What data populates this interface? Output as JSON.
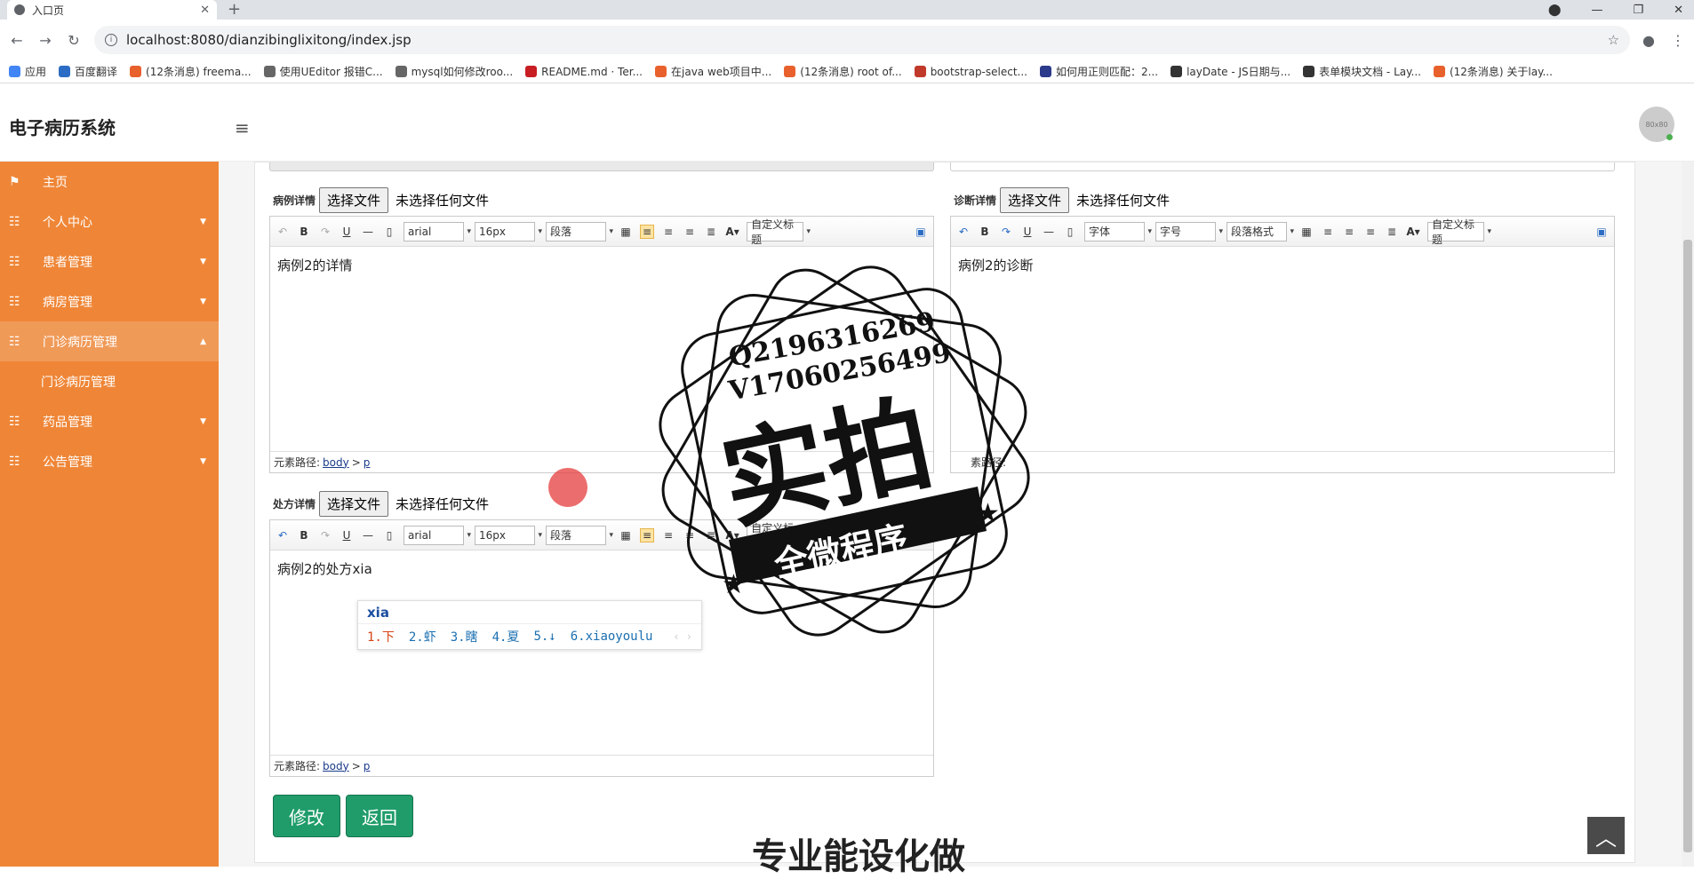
{
  "browser": {
    "tab_title": "入口页",
    "tab_close": "✕",
    "new_tab": "+",
    "url": "localhost:8080/dianzibinglixitong/index.jsp",
    "bookmarks": [
      {
        "label": "应用",
        "color": "#4285f4"
      },
      {
        "label": "百度翻译",
        "color": "#2b6cc4"
      },
      {
        "label": "(12条消息) freema...",
        "color": "#e8612c"
      },
      {
        "label": "使用UEditor 报错C...",
        "color": "#666666"
      },
      {
        "label": "mysql如何修改roo...",
        "color": "#666666"
      },
      {
        "label": "README.md · Ter...",
        "color": "#c71d23"
      },
      {
        "label": "在java web项目中...",
        "color": "#e8612c"
      },
      {
        "label": "(12条消息) root of...",
        "color": "#e8612c"
      },
      {
        "label": "bootstrap-select...",
        "color": "#c0392b"
      },
      {
        "label": "如何用正则匹配：2...",
        "color": "#2b3a8a"
      },
      {
        "label": "layDate - JS日期与...",
        "color": "#333333"
      },
      {
        "label": "表单模块文档 - Lay...",
        "color": "#333333"
      },
      {
        "label": "(12条消息) 关于lay...",
        "color": "#e8612c"
      }
    ]
  },
  "header": {
    "brand": "电子病历系统",
    "avatar_text": "80x80"
  },
  "sidebar": {
    "items": [
      {
        "label": "主页",
        "caret": ""
      },
      {
        "label": "个人中心",
        "caret": "▼"
      },
      {
        "label": "患者管理",
        "caret": "▼"
      },
      {
        "label": "病房管理",
        "caret": "▼"
      },
      {
        "label": "门诊病历管理",
        "caret": "▲"
      },
      {
        "label": "药品管理",
        "caret": "▼"
      },
      {
        "label": "公告管理",
        "caret": "▼"
      }
    ],
    "sub_item": "门诊病历管理"
  },
  "form": {
    "file_button": "选择文件",
    "file_none": "未选择任何文件",
    "case_label": "病例详情",
    "diag_label": "诊断详情",
    "rx_label": "处方详情",
    "case_content": "病例2的详情",
    "diag_content": "病例2的诊断",
    "rx_content": "病例2的处方xia",
    "path_label": "元素路径:",
    "path_body": "body",
    "path_sep": ">",
    "path_p": "p",
    "diag_path_label": "素路径:"
  },
  "toolbar_left": {
    "font": "arial",
    "size": "16px",
    "block": "段落",
    "custom": "自定义标题"
  },
  "toolbar_right": {
    "font": "字体",
    "size": "字号",
    "block": "段落格式",
    "custom": "自定义标题"
  },
  "ime": {
    "input": "xia",
    "candidates": [
      "1.下",
      "2.虾",
      "3.瞎",
      "4.夏",
      "5.↓",
      "6.xiaoyoulu"
    ],
    "pager": "‹ ›"
  },
  "buttons": {
    "edit": "修改",
    "back": "返回"
  },
  "watermark": {
    "line1": "Q2196316269",
    "line2": "V17060256499",
    "big": "实拍",
    "banner": "全微程序"
  },
  "bottom_text": "专业能设化做"
}
